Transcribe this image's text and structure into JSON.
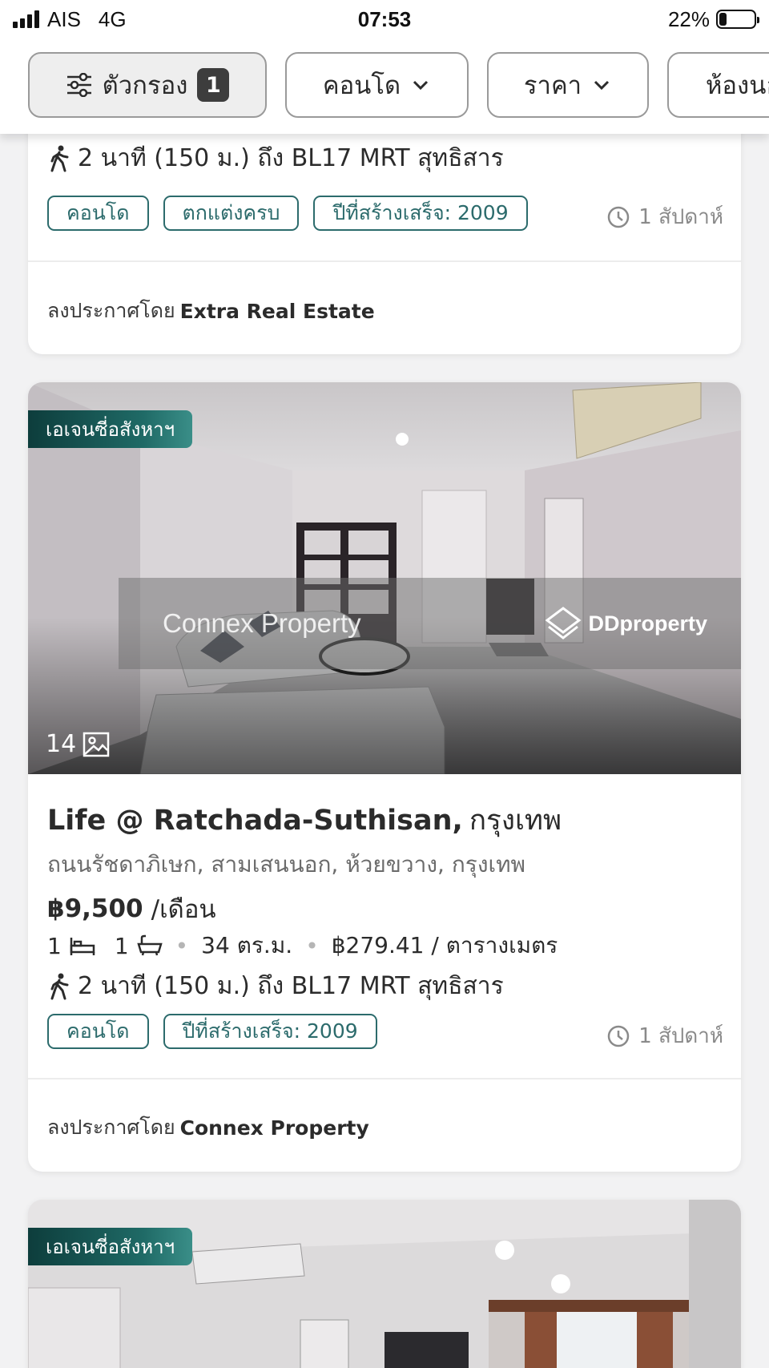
{
  "status_bar": {
    "carrier": "AIS",
    "network": "4G",
    "time": "07:53",
    "battery_percent": "22%",
    "battery_level": 0.22
  },
  "filter_bar": {
    "filter_label": "ตัวกรอง",
    "filter_count": "1",
    "property_type": "คอนโด",
    "price": "ราคา",
    "rooms": "ห้องนอน"
  },
  "listings": [
    {
      "transit": "2 นาที (150 ม.) ถึง BL17 MRT สุทธิสาร",
      "tags": [
        "คอนโด",
        "ตกแต่งครบ",
        "ปีที่สร้างเสร็จ: 2009"
      ],
      "posted_time": "1 สัปดาห์",
      "posted_by_prefix": "ลงประกาศโดย",
      "posted_by": "Extra Real Estate"
    },
    {
      "agent_badge": "เอเจนซี่อสังหาฯ",
      "watermark_left": "Connex Property",
      "watermark_right": "DDproperty",
      "photo_count": "14",
      "title": "Life @ Ratchada-Suthisan,",
      "title_city": "กรุงเทพ",
      "address": "ถนนรัชดาภิเษก, สามเสนนอก, ห้วยขวาง, กรุงเทพ",
      "price": "฿9,500",
      "price_unit": "/เดือน",
      "bedrooms": "1",
      "bathrooms": "1",
      "area": "34 ตร.ม.",
      "price_per_sqm": "฿279.41 / ตารางเมตร",
      "transit": "2 นาที (150 ม.) ถึง BL17 MRT สุทธิสาร",
      "tags": [
        "คอนโด",
        "ปีที่สร้างเสร็จ: 2009"
      ],
      "posted_time": "1 สัปดาห์",
      "posted_by_prefix": "ลงประกาศโดย",
      "posted_by": "Connex Property"
    },
    {
      "agent_badge": "เอเจนซี่อสังหาฯ"
    }
  ],
  "colors": {
    "accent": "#2c6b6c",
    "badge_dark": "#0d3d3c",
    "background": "#f2f2f3"
  }
}
